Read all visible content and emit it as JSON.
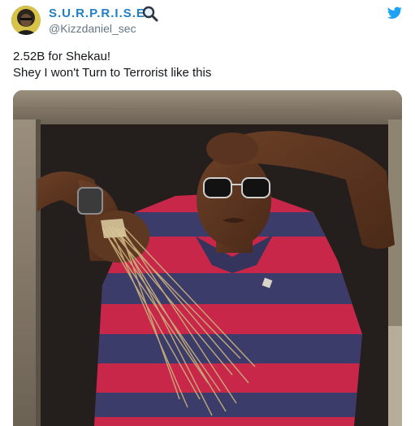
{
  "user": {
    "display_name": "S.U.R.P.R.I.S.E",
    "handle": "@Kizzdaniel_sec",
    "display_name_emoji_icon": "magnifier-icon"
  },
  "brand": {
    "icon": "twitter-bird-icon",
    "color": "#1da1f2"
  },
  "tweet": {
    "line1": "2.52B for Shekau!",
    "line2": "Shey I won't Turn to Terrorist like this"
  },
  "media": {
    "type": "photo",
    "subject": "man-in-striped-polo-with-broom",
    "colors": {
      "stripe_red": "#c8274a",
      "stripe_navy": "#3c3c6a",
      "frame_wood": "#8a7f6f"
    }
  }
}
